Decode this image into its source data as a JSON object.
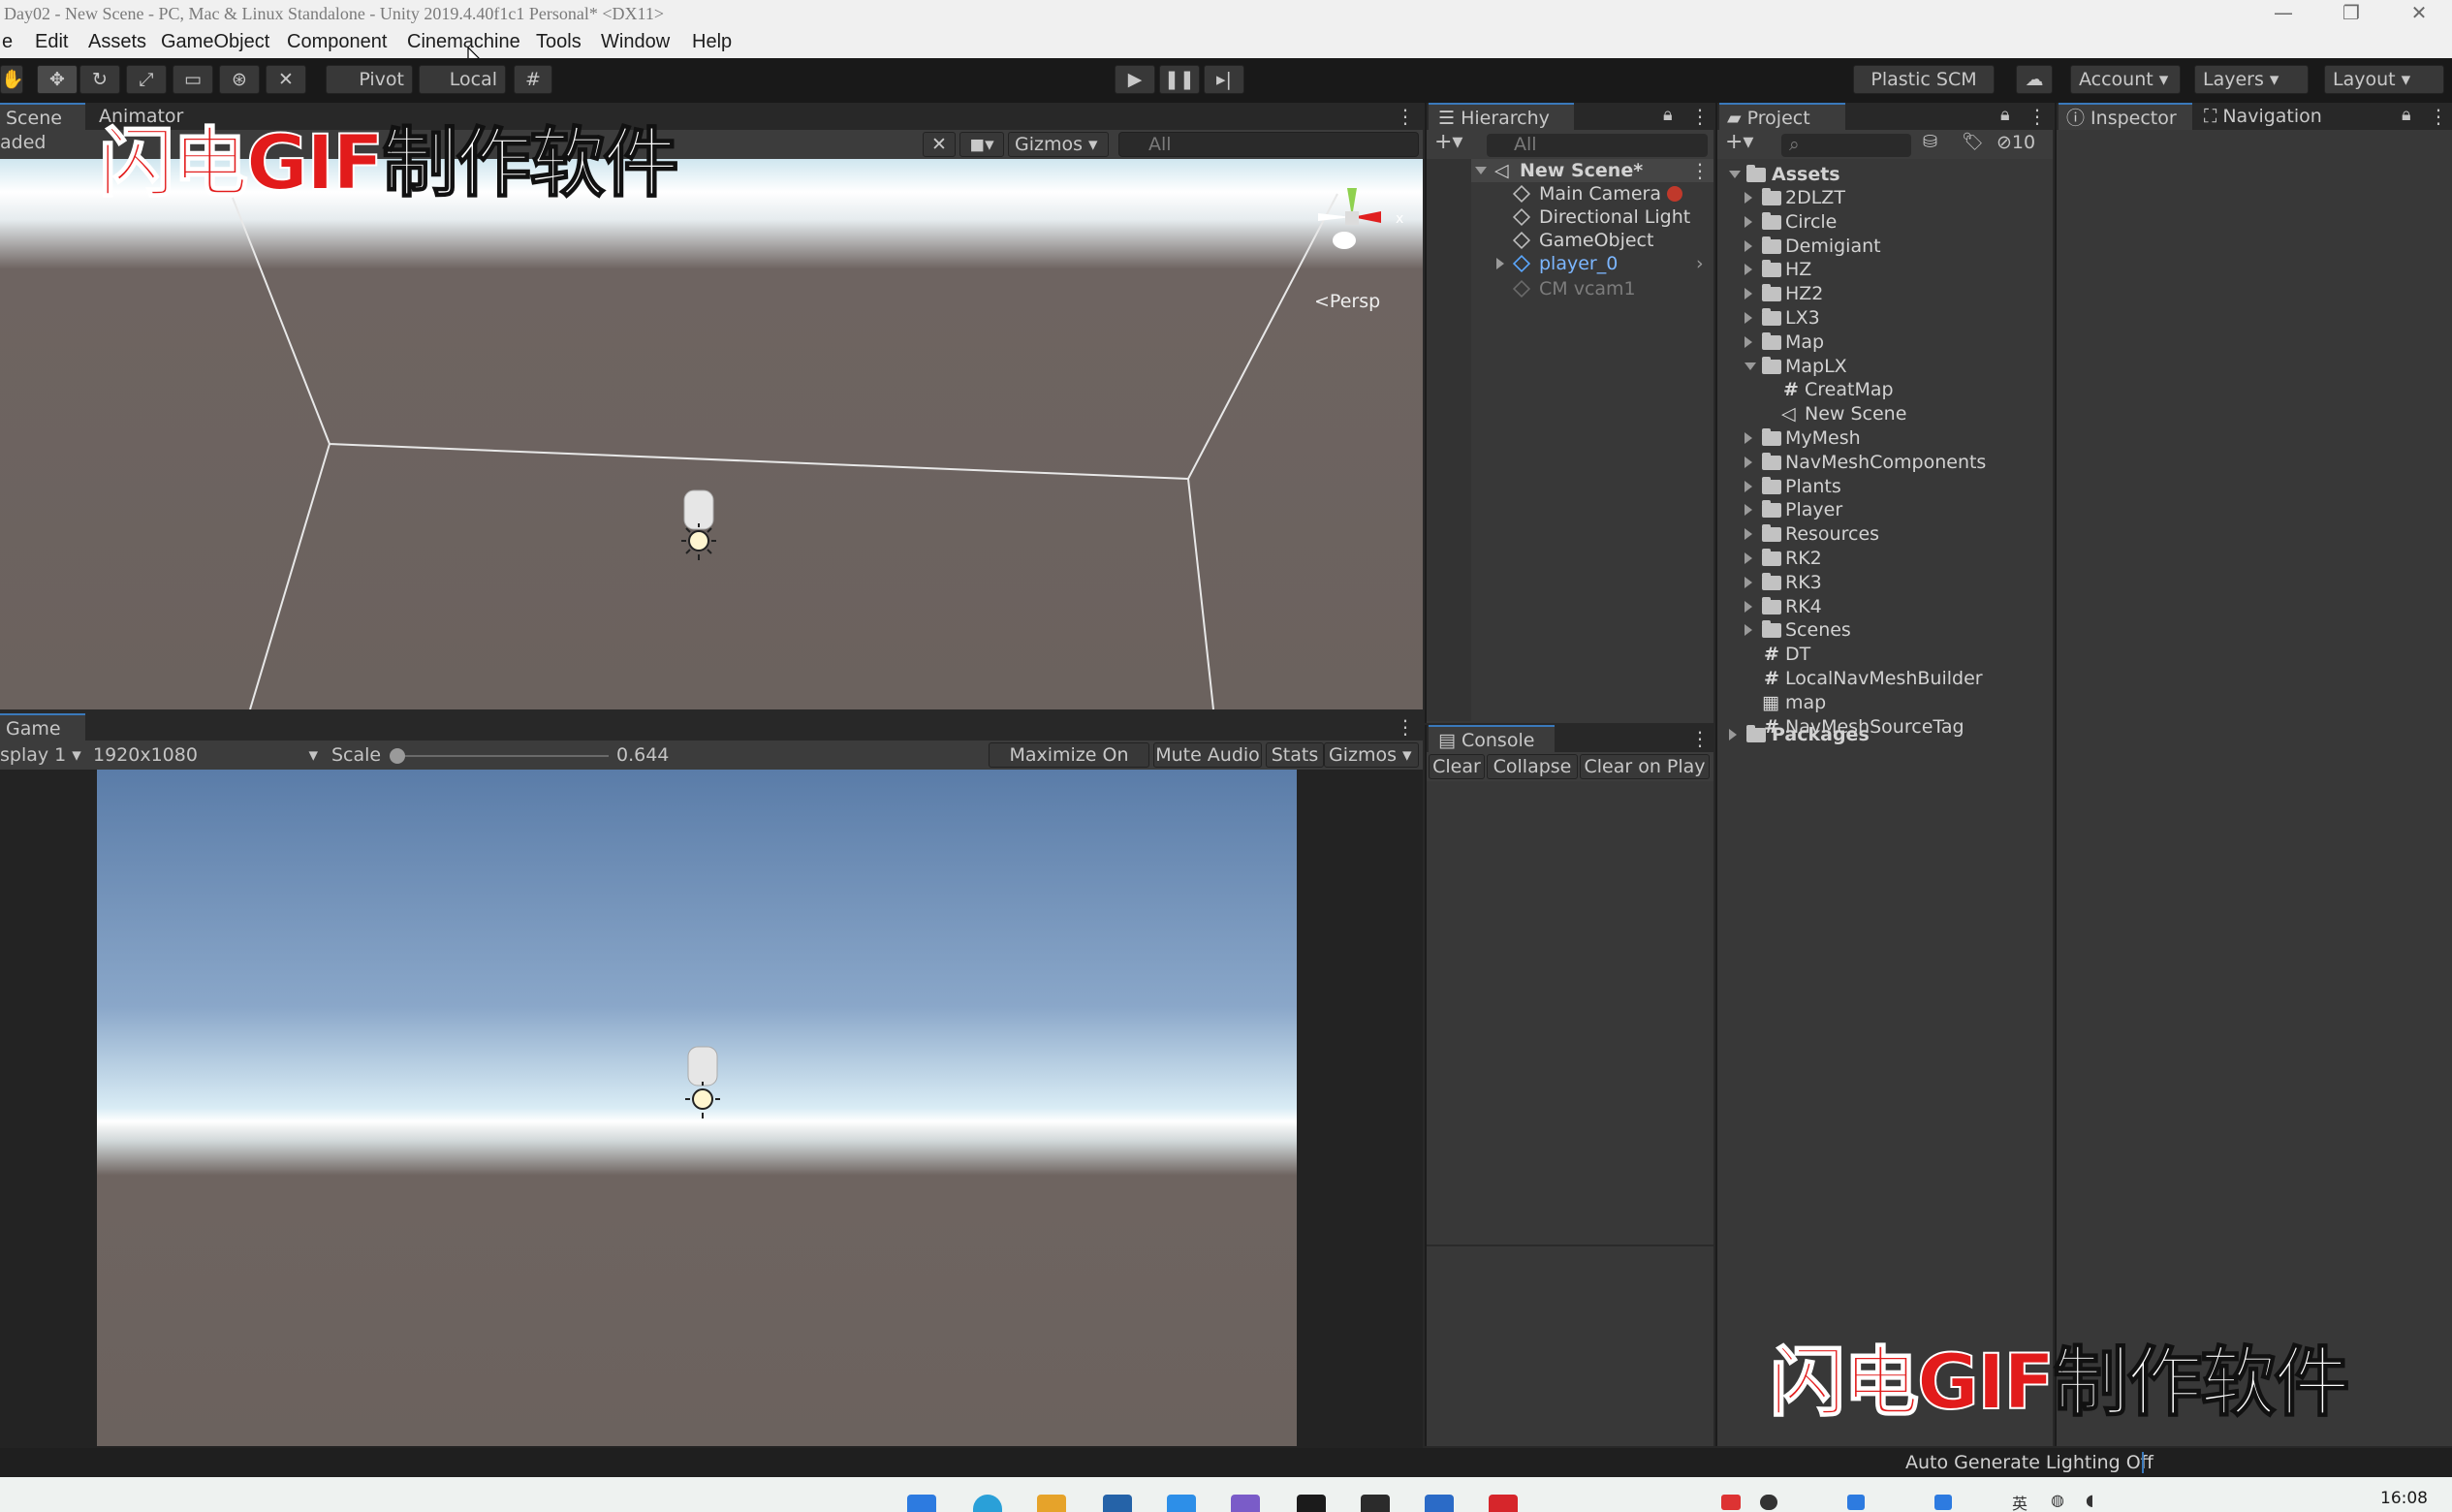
{
  "window": {
    "title": "Day02 - New Scene - PC, Mac & Linux Standalone - Unity 2019.4.40f1c1 Personal* <DX11>",
    "controls": [
      "—",
      "❐",
      "✕"
    ]
  },
  "menu": [
    "e",
    "Edit",
    "Assets",
    "GameObject",
    "Component",
    "Cinemachine",
    "Tools",
    "Window",
    "Help"
  ],
  "toolbar": {
    "pivot": "Pivot",
    "local": "Local",
    "plastic": "Plastic SCM",
    "account": "Account",
    "layers": "Layers",
    "layout": "Layout"
  },
  "scene": {
    "tab_scene": "Scene",
    "tab_animator": "Animator",
    "loaded": "aded",
    "gizmos": "Gizmos",
    "search_placeholder": "All",
    "persp": "Persp"
  },
  "game": {
    "tab": "Game",
    "display": "splay 1",
    "resolution": "1920x1080",
    "scale_label": "Scale",
    "scale_value": "0.644",
    "buttons": [
      "Maximize On Play",
      "Mute Audio",
      "Stats",
      "Gizmos"
    ]
  },
  "hierarchy": {
    "tab": "Hierarchy",
    "search_placeholder": "All",
    "scene": "New Scene*",
    "items": [
      "Main Camera",
      "Directional Light",
      "GameObject",
      "player_0",
      "CM vcam1"
    ]
  },
  "console": {
    "tab": "Console",
    "buttons": [
      "Clear",
      "Collapse",
      "Clear on Play"
    ]
  },
  "project": {
    "tab": "Project",
    "hidden_count": "10",
    "root": "Assets",
    "items": [
      "2DLZT",
      "Circle",
      "Demigiant",
      "HZ",
      "HZ2",
      "LX3",
      "Map",
      "MapLX",
      "CreatMap",
      "New Scene",
      "MyMesh",
      "NavMeshComponents",
      "Plants",
      "Player",
      "Resources",
      "RK2",
      "RK3",
      "RK4",
      "Scenes",
      "DT",
      "LocalNavMeshBuilder",
      "map",
      "NavMeshSourceTag"
    ],
    "packages": "Packages"
  },
  "inspector": {
    "tab_inspector": "Inspector",
    "tab_navigation": "Navigation"
  },
  "status": {
    "lighting": "Auto Generate Lighting Off"
  },
  "watermark": {
    "red": "闪电GIF",
    "white": "制作软件"
  },
  "taskbar": {
    "time": "16:08",
    "lang": "英"
  },
  "colors": {
    "accent_blue": "#3a79bb",
    "panel": "#383838",
    "watermark_red": "#e21b1b"
  }
}
